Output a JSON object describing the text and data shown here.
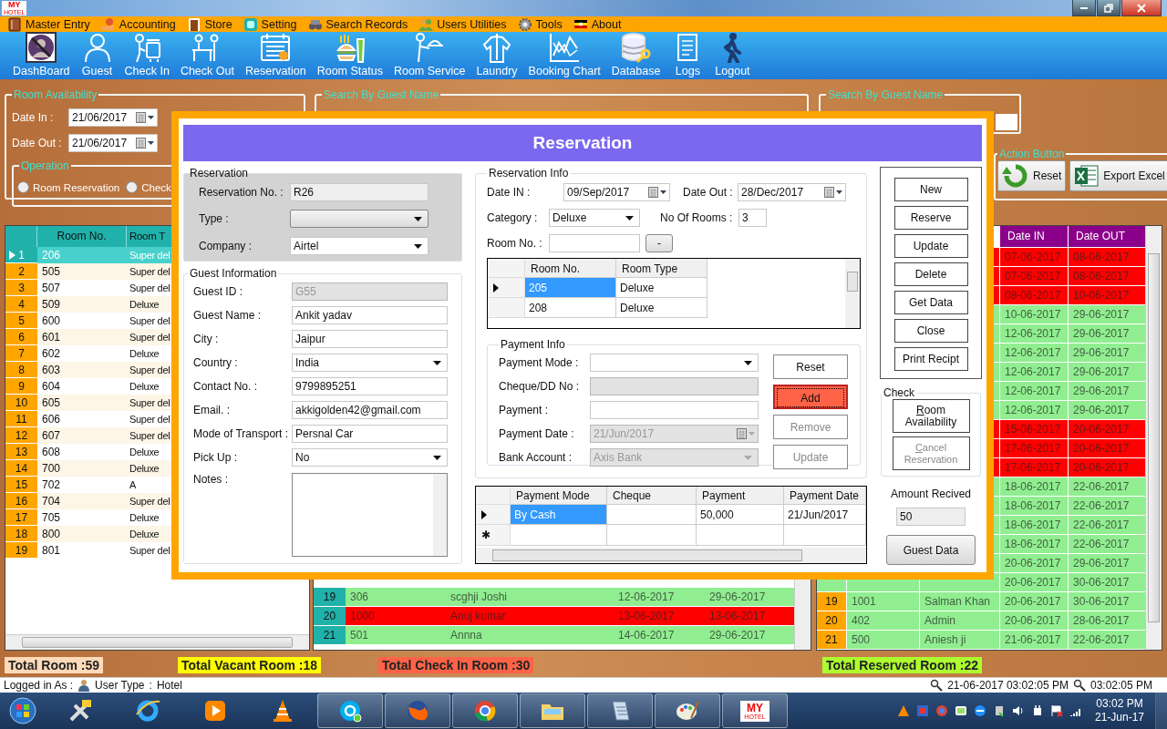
{
  "title_bar": {
    "logo": "MY",
    "logo_sub": "HOTEL"
  },
  "menu": [
    {
      "label": "Master Entry"
    },
    {
      "label": "Accounting"
    },
    {
      "label": "Store"
    },
    {
      "label": "Setting"
    },
    {
      "label": "Search Records"
    },
    {
      "label": "Users Utilities"
    },
    {
      "label": "Tools"
    },
    {
      "label": "About"
    }
  ],
  "toolbar": [
    {
      "label": "DashBoard"
    },
    {
      "label": "Guest"
    },
    {
      "label": "Check In"
    },
    {
      "label": "Check Out"
    },
    {
      "label": "Reservation"
    },
    {
      "label": "Room Status"
    },
    {
      "label": "Room Service"
    },
    {
      "label": "Laundry"
    },
    {
      "label": "Booking Chart"
    },
    {
      "label": "Database"
    },
    {
      "label": "Logs"
    },
    {
      "label": "Logout"
    }
  ],
  "room_availability": {
    "title": "Room Availability",
    "date_in_label": "Date In :",
    "date_in": "21/06/2017",
    "date_out_label": "Date Out :",
    "date_out": "21/06/2017",
    "operation": {
      "title": "Operation",
      "options": [
        {
          "label": "Room Reservation",
          "selected": false
        },
        {
          "label": "Check",
          "selected": false
        }
      ]
    }
  },
  "search_groups": [
    {
      "title": "Search By Guest Name"
    },
    {
      "title": "Search By Guest Name"
    }
  ],
  "action_group": {
    "title": "Action Button",
    "buttons": [
      "Reset",
      "Export Excel"
    ]
  },
  "rooms_table": {
    "columns": [
      "Room No.",
      "Room T"
    ],
    "rows": [
      {
        "number": "1",
        "room": "206",
        "type": "Super del",
        "selected": true
      },
      {
        "number": "2",
        "room": "505",
        "type": "Super del",
        "selected": false
      },
      {
        "number": "3",
        "room": "507",
        "type": "Super del",
        "selected": false
      },
      {
        "number": "4",
        "room": "509",
        "type": "Deluxe",
        "selected": false
      },
      {
        "number": "5",
        "room": "600",
        "type": "Super del",
        "selected": false
      },
      {
        "number": "6",
        "room": "601",
        "type": "Super del",
        "selected": false
      },
      {
        "number": "7",
        "room": "602",
        "type": "Deluxe",
        "selected": false
      },
      {
        "number": "8",
        "room": "603",
        "type": "Super del",
        "selected": false
      },
      {
        "number": "9",
        "room": "604",
        "type": "Deluxe",
        "selected": false
      },
      {
        "number": "10",
        "room": "605",
        "type": "Super del",
        "selected": false
      },
      {
        "number": "11",
        "room": "606",
        "type": "Super del",
        "selected": false
      },
      {
        "number": "12",
        "room": "607",
        "type": "Super del",
        "selected": false
      },
      {
        "number": "13",
        "room": "608",
        "type": "Deluxe",
        "selected": false
      },
      {
        "number": "14",
        "room": "700",
        "type": "Deluxe",
        "selected": false
      },
      {
        "number": "15",
        "room": "702",
        "type": "A",
        "selected": false
      },
      {
        "number": "16",
        "room": "704",
        "type": "Super del",
        "selected": false
      },
      {
        "number": "17",
        "room": "705",
        "type": "Deluxe",
        "selected": false
      },
      {
        "number": "18",
        "room": "800",
        "type": "Deluxe",
        "selected": false
      },
      {
        "number": "19",
        "room": "801",
        "type": "Super del",
        "selected": false
      }
    ]
  },
  "checkin_table": {
    "rows": [
      {
        "number": "19",
        "room": "306",
        "name": "scghji Joshi",
        "date_in": "12-06-2017",
        "date_out": "29-06-2017",
        "color": "#90ee90"
      },
      {
        "number": "20",
        "room": "1000",
        "name": "Anuj kumar",
        "date_in": "13-06-2017",
        "date_out": "13-06-2017",
        "color": "#ff0000"
      },
      {
        "number": "21",
        "room": "501",
        "name": "Annna",
        "date_in": "14-06-2017",
        "date_out": "29-06-2017",
        "color": "#90ee90"
      }
    ]
  },
  "reserved_table": {
    "columns": [
      "Date IN",
      "Date OUT"
    ],
    "rows": [
      {
        "date_in": "07-06-2017",
        "date_out": "08-06-2017",
        "color": "#ff0000"
      },
      {
        "date_in": "07-06-2017",
        "date_out": "08-06-2017",
        "color": "#ff0000"
      },
      {
        "date_in": "08-06-2017",
        "date_out": "10-06-2017",
        "color": "#ff0000"
      },
      {
        "date_in": "10-06-2017",
        "date_out": "29-06-2017",
        "color": "#90ee90"
      },
      {
        "date_in": "12-06-2017",
        "date_out": "29-06-2017",
        "color": "#90ee90"
      },
      {
        "date_in": "12-06-2017",
        "date_out": "29-06-2017",
        "color": "#90ee90"
      },
      {
        "date_in": "12-06-2017",
        "date_out": "29-06-2017",
        "color": "#90ee90"
      },
      {
        "date_in": "12-06-2017",
        "date_out": "29-06-2017",
        "color": "#90ee90"
      },
      {
        "date_in": "12-06-2017",
        "date_out": "29-06-2017",
        "color": "#90ee90"
      },
      {
        "date_in": "15-06-2017",
        "date_out": "20-06-2017",
        "color": "#ff0000"
      },
      {
        "date_in": "17-06-2017",
        "date_out": "20-06-2017",
        "color": "#ff0000"
      },
      {
        "date_in": "17-06-2017",
        "date_out": "20-06-2017",
        "color": "#ff0000"
      },
      {
        "date_in": "18-06-2017",
        "date_out": "22-06-2017",
        "color": "#90ee90"
      },
      {
        "date_in": "18-06-2017",
        "date_out": "22-06-2017",
        "color": "#90ee90"
      },
      {
        "date_in": "18-06-2017",
        "date_out": "22-06-2017",
        "color": "#90ee90"
      },
      {
        "date_in": "18-06-2017",
        "date_out": "22-06-2017",
        "color": "#90ee90"
      },
      {
        "date_in": "20-06-2017",
        "date_out": "29-06-2017",
        "color": "#90ee90"
      },
      {
        "date_in": "20-06-2017",
        "date_out": "30-06-2017",
        "color": "#90ee90"
      },
      {
        "number": "19",
        "room": "1001",
        "name": "Salman Khan",
        "date_in": "20-06-2017",
        "date_out": "30-06-2017",
        "color": "#90ee90"
      },
      {
        "number": "20",
        "room": "402",
        "name": "Admin",
        "date_in": "20-06-2017",
        "date_out": "28-06-2017",
        "color": "#90ee90"
      },
      {
        "number": "21",
        "room": "500",
        "name": "Aniesh ji",
        "date_in": "21-06-2017",
        "date_out": "22-06-2017",
        "color": "#90ee90"
      }
    ]
  },
  "totals": [
    {
      "text": "Total Room :59",
      "color": "#ffdab9"
    },
    {
      "text": "Total Vacant Room :18",
      "color": "#ffff00"
    },
    {
      "text": "Total Check In Room :30",
      "color": "#ff6347"
    },
    {
      "text": "Total Reserved Room :22",
      "color": "#adff2f"
    }
  ],
  "reservation_dialog": {
    "title": "Reservation",
    "reservation_group": {
      "title": "Reservation",
      "fields": [
        {
          "label": "Reservation No. :",
          "kind": "readonly",
          "value": "R26"
        },
        {
          "label": "Type :",
          "kind": "combo"
        },
        {
          "label": "Company :",
          "kind": "dropdown",
          "value": "Airtel"
        }
      ]
    },
    "guest_group": {
      "title": "Guest Information",
      "fields": [
        {
          "label": "Guest ID :",
          "kind": "text",
          "value": "G55",
          "disabled": true
        },
        {
          "label": "Guest Name :",
          "kind": "text",
          "value": "Ankit yadav",
          "disabled": false
        },
        {
          "label": "City :",
          "kind": "text",
          "value": "Jaipur",
          "disabled": false
        },
        {
          "label": "Country :",
          "kind": "dropdown",
          "value": "India",
          "disabled": false
        },
        {
          "label": "Contact No. :",
          "kind": "text",
          "value": "9799895251",
          "disabled": false
        },
        {
          "label": "Email. :",
          "kind": "text",
          "value": "akkigolden42@gmail.com",
          "disabled": false
        },
        {
          "label": "Mode of Transport :",
          "kind": "text",
          "value": "Persnal Car",
          "disabled": false
        },
        {
          "label": "Pick Up :",
          "kind": "dropdown",
          "value": "No",
          "disabled": false
        },
        {
          "label": "Notes :",
          "kind": "textarea",
          "disabled": false
        }
      ]
    },
    "reservation_info": {
      "title": "Reservation Info",
      "date_in": {
        "label": "Date IN :",
        "value": "09/Sep/2017"
      },
      "date_out": {
        "label": "Date Out :",
        "value": "28/Dec/2017"
      },
      "category": {
        "label": "Category :",
        "value": "Deluxe"
      },
      "no_of_rooms": {
        "label": "No Of Rooms :",
        "value": "3"
      },
      "room_no": {
        "label": "Room No. :"
      },
      "remove_room_button": "-",
      "rooms": {
        "columns": [
          "Room No.",
          "Room Type"
        ],
        "rows": [
          {
            "room": "205",
            "type": "Deluxe",
            "selected": true
          },
          {
            "room": "208",
            "type": "Deluxe",
            "selected": false
          }
        ]
      }
    },
    "payment_info": {
      "title": "Payment Info",
      "fields": [
        {
          "label": "Payment Mode :",
          "kind": "dropdown",
          "disabled": false
        },
        {
          "label": "Cheque/DD No :",
          "kind": "text",
          "disabled": true
        },
        {
          "label": "Payment :",
          "kind": "text",
          "disabled": false
        },
        {
          "label": "Payment Date :",
          "kind": "date",
          "value": "21/Jun/2017",
          "disabled": true
        },
        {
          "label": "Bank Account :",
          "kind": "dropdown",
          "value": "Axis Bank",
          "disabled": true
        }
      ],
      "buttons": [
        {
          "label": "Reset",
          "highlighted": false,
          "disabled": false
        },
        {
          "label": "Add",
          "highlighted": true,
          "disabled": false
        },
        {
          "label": "Remove",
          "highlighted": false,
          "disabled": true
        },
        {
          "label": "Update",
          "highlighted": false,
          "disabled": true
        }
      ]
    },
    "payments": {
      "columns": [
        "Payment Mode",
        "Cheque",
        "Payment",
        "Payment Date"
      ],
      "rows": [
        {
          "mode": "By Cash",
          "payment": "50,000",
          "date": "21/Jun/2017",
          "selected": true
        }
      ],
      "new_row_marker": "✱"
    },
    "actions": [
      "New",
      "Reserve",
      "Update",
      "Delete",
      "Get Data",
      "Close",
      "Print Recipt"
    ],
    "check": {
      "title": "Check",
      "buttons": [
        {
          "label": "Room Availability",
          "disabled": false
        },
        {
          "label": "Cancel Reservation",
          "disabled": true
        }
      ]
    },
    "amount_received": {
      "label": "Amount Recived",
      "value": "50"
    },
    "guest_data_button": "Guest Data"
  },
  "status_bar": {
    "logged_in_label": "Logged in As :",
    "user_type_label": "User Type",
    "separator": ":",
    "user_type": "Hotel",
    "datetime": "21-06-2017 03:02:05 PM",
    "time": "03:02:05 PM"
  },
  "taskbar": {
    "app_logo": "MY",
    "app_logo_sub": "HOTEL",
    "clock_time": "03:02 PM",
    "clock_date": "21-Jun-17"
  }
}
